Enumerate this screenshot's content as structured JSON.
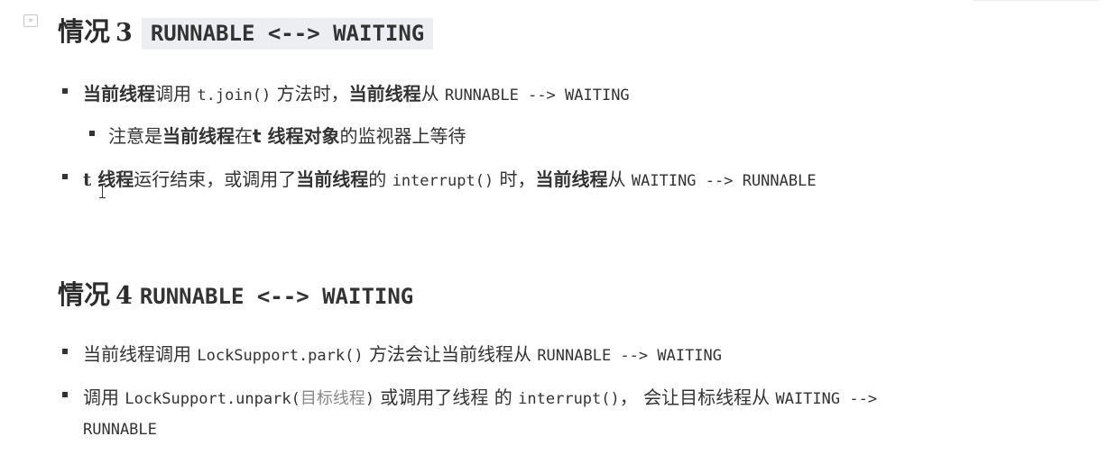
{
  "case3": {
    "heading": "情况",
    "number": "3",
    "code": "RUNNABLE <--> WAITING",
    "items": [
      {
        "p1": "当前线程",
        "p2": "调用 ",
        "code1": "t.join()",
        "p3": " 方法时，",
        "p4": "当前线程",
        "p5": "从 ",
        "code2": "RUNNABLE --> WAITING"
      }
    ],
    "sub_item": {
      "p1": "注意是",
      "p2": "当前线程",
      "p3": "在",
      "p4": "t 线程对象",
      "p5": "的监视器上等待"
    },
    "item2": {
      "p1": "t",
      "p2": " 线程",
      "p3": "运行结束，或调用了",
      "p4": "当前线程",
      "p5": "的 ",
      "code1": "interrupt()",
      "p6": " 时，",
      "p7": "当前线程",
      "p8": "从 ",
      "code2": "WAITING --> RUNNABLE"
    }
  },
  "case4": {
    "heading": "情况",
    "number": "4",
    "code": "RUNNABLE <--> WAITING",
    "item1": {
      "p1": "当前线程调用 ",
      "code1": "LockSupport.park()",
      "p2": " 方法会让当前线程从 ",
      "code2": "RUNNABLE --> WAITING"
    },
    "item2": {
      "p1": "调用 ",
      "code1": "LockSupport.unpark(",
      "p2": "目标线程",
      "code2": ")",
      "p3": " 或调用了线程 的 ",
      "code3": "interrupt()",
      "p4": "， 会让目标线程从 ",
      "code4": "WAITING -->",
      "code5": "RUNNABLE"
    }
  }
}
